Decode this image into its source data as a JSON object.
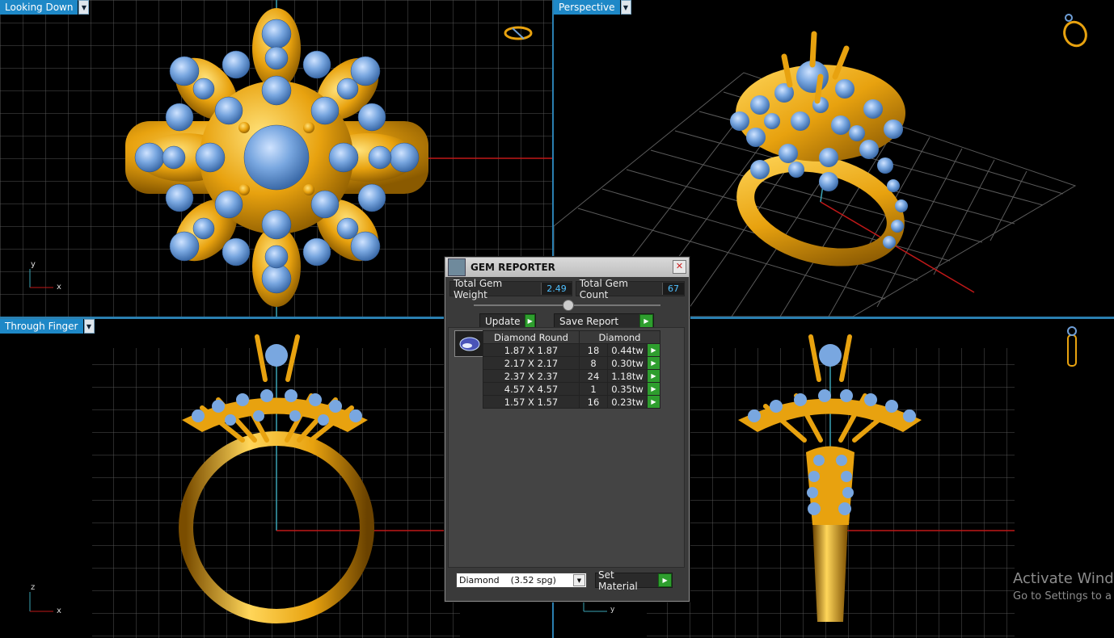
{
  "viewports": {
    "top_left": {
      "label": "Looking Down"
    },
    "top_right": {
      "label": "Perspective"
    },
    "bottom_left": {
      "label": "Through Finger"
    },
    "bottom_right": {
      "label": ""
    }
  },
  "axes": {
    "top_left": {
      "a": "y",
      "b": "x"
    },
    "bottom_left": {
      "a": "z",
      "b": "x"
    },
    "bottom_right": {
      "a": "y"
    }
  },
  "gem_reporter": {
    "title": "GEM REPORTER",
    "total_weight_label": "Total Gem Weight",
    "total_weight_value": "2.49",
    "total_count_label": "Total Gem Count",
    "total_count_value": "67",
    "update_label": "Update",
    "save_report_label": "Save Report",
    "table": {
      "headers": [
        "Diamond Round",
        "Diamond"
      ],
      "rows": [
        {
          "size": "1.87 X 1.87",
          "count": "18",
          "weight": "0.44tw"
        },
        {
          "size": "2.17 X 2.17",
          "count": "8",
          "weight": "0.30tw"
        },
        {
          "size": "2.37 X 2.37",
          "count": "24",
          "weight": "1.18tw"
        },
        {
          "size": "4.57 X 4.57",
          "count": "1",
          "weight": "0.35tw"
        },
        {
          "size": "1.57 X 1.57",
          "count": "16",
          "weight": "0.23tw"
        }
      ]
    },
    "material_select": "Diamond    (3.52 spg)",
    "set_material_label": "Set Material"
  },
  "watermark": {
    "line1": "Activate Wind",
    "line2": "Go to Settings to a"
  },
  "colors": {
    "gold": "#e8a20f",
    "gem": "#6f9fd8",
    "accent": "#1e88c7",
    "go": "#2e9e2e"
  },
  "icons": [
    "view-ring-icon",
    "gem-thumbnail-icon",
    "close-icon",
    "play-icon",
    "chevron-down-icon"
  ]
}
